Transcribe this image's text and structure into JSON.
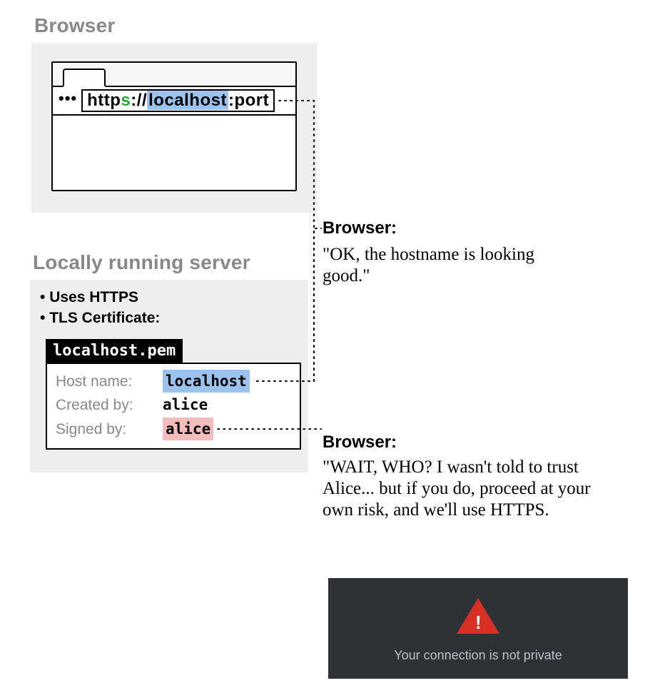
{
  "browser": {
    "title": "Browser",
    "toolbar_dots": "•••",
    "url": {
      "http": "http",
      "s": "s",
      "sep": "://",
      "host": "localhost",
      "rest": ":port"
    }
  },
  "server": {
    "title": "Locally running server",
    "bullets": {
      "uses_https": "Uses HTTPS",
      "tls_cert": "TLS Certificate:"
    },
    "cert_filename": "localhost.pem",
    "cert": {
      "hostname_label": "Host name:",
      "hostname_value": "localhost",
      "createdby_label": "Created by:",
      "createdby_value": "alice",
      "signedby_label": "Signed by:",
      "signedby_value": "alice"
    }
  },
  "annotations": {
    "hostname_ok": {
      "speaker": "Browser:",
      "quote": "\"OK, the hostname is looking good.\""
    },
    "signed_warn": {
      "speaker": "Browser:",
      "quote": "\"WAIT, WHO? I wasn't told to trust Alice... but if you do, proceed at your own risk, and we'll use HTTPS."
    }
  },
  "warning_box": {
    "text": "Your connection is not private"
  }
}
